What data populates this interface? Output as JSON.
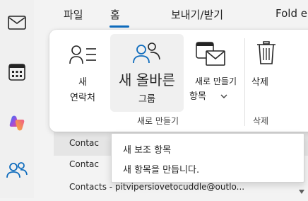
{
  "tabs": [
    {
      "label": "파일"
    },
    {
      "label": "홈"
    },
    {
      "label": "보내기/받기"
    },
    {
      "label": "Fold e"
    }
  ],
  "active_tab": "홈",
  "ribbon": {
    "new_contact": {
      "line1": "새",
      "line2": "연락처"
    },
    "new_group": {
      "line1": "새 올바른",
      "line2": "그룹"
    },
    "new_items": {
      "line1": "새로 만들기",
      "line2": "항목"
    },
    "delete": {
      "label": "삭제"
    },
    "groups": {
      "new": "새로 만들기",
      "delete": "삭제"
    }
  },
  "list": {
    "rows": [
      {
        "text": "Contac"
      },
      {
        "text": "Contac"
      },
      {
        "text": "Contacts - pitvipersiovetocuddle@outlo..."
      }
    ]
  },
  "tooltip": {
    "title": "새 보조 항목",
    "description": "새 항목을 만듭니다."
  },
  "colors": {
    "accent": "#0f6cbd",
    "copilot": "#e04f9a"
  },
  "icons": [
    "mail-icon",
    "calendar-icon",
    "copilot-icon",
    "people-icon",
    "contact-card-icon",
    "group-icon",
    "new-items-icon",
    "delete-icon",
    "chevron-down-icon"
  ]
}
